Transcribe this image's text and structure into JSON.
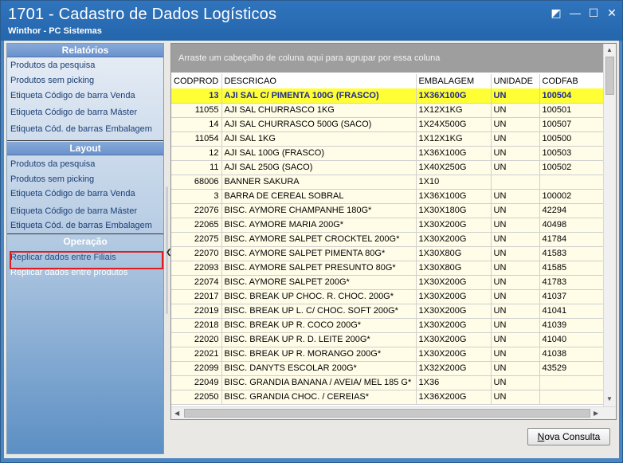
{
  "window": {
    "title": "1701 - Cadastro de Dados Logísticos",
    "subtitle": "Winthor - PC Sistemas",
    "controls": [
      "◩",
      "—",
      "☐",
      "✕"
    ]
  },
  "sidebar": {
    "sections": [
      {
        "header": "Relatórios",
        "items": [
          "Produtos da pesquisa",
          "Produtos sem picking",
          "Etiqueta Código de barra Venda",
          "Etiqueta Código de barra Máster",
          "Etiqueta Cód. de barras Embalagem"
        ]
      },
      {
        "header": "Layout",
        "items": [
          "Produtos da pesquisa",
          "Produtos sem picking",
          "Etiqueta Código de barra Venda",
          "Etiqueta Código de barra Máster",
          "Etiqueta Cód. de barras Embalagem"
        ]
      },
      {
        "header": "Operação",
        "items": [
          "Replicar dados entre Filiais",
          "Replicar dados entre produtos"
        ]
      }
    ]
  },
  "grid": {
    "group_panel_text": "Arraste um cabeçalho de coluna aqui para agrupar por essa coluna",
    "columns": [
      "CODPROD",
      "DESCRICAO",
      "EMBALAGEM",
      "UNIDADE",
      "CODFAB"
    ],
    "rows": [
      [
        "13",
        "AJI SAL C/ PIMENTA 100G (FRASCO)",
        "1X36X100G",
        "UN",
        "100504"
      ],
      [
        "11055",
        "AJI SAL CHURRASCO 1KG",
        "1X12X1KG",
        "UN",
        "100501"
      ],
      [
        "14",
        "AJI SAL CHURRASCO 500G (SACO)",
        "1X24X500G",
        "UN",
        "100507"
      ],
      [
        "11054",
        "AJI SAL 1KG",
        "1X12X1KG",
        "UN",
        "100500"
      ],
      [
        "12",
        "AJI SAL 100G (FRASCO)",
        "1X36X100G",
        "UN",
        "100503"
      ],
      [
        "11",
        "AJI SAL 250G (SACO)",
        "1X40X250G",
        "UN",
        "100502"
      ],
      [
        "68006",
        "BANNER SAKURA",
        "1X10",
        "",
        ""
      ],
      [
        "3",
        "BARRA DE CEREAL SOBRAL",
        "1X36X100G",
        "UN",
        "100002"
      ],
      [
        "22076",
        "BISC. AYMORE CHAMPANHE  180G*",
        "1X30X180G",
        "UN",
        "42294"
      ],
      [
        "22065",
        "BISC. AYMORE MARIA 200G*",
        "1X30X200G",
        "UN",
        "40498"
      ],
      [
        "22075",
        "BISC. AYMORE SALPET CROCKTEL 200G*",
        "1X30X200G",
        "UN",
        "41784"
      ],
      [
        "22070",
        "BISC. AYMORE SALPET PIMENTA 80G*",
        "1X30X80G",
        "UN",
        "41583"
      ],
      [
        "22093",
        "BISC. AYMORE SALPET PRESUNTO 80G*",
        "1X30X80G",
        "UN",
        "41585"
      ],
      [
        "22074",
        "BISC. AYMORE SALPET 200G*",
        "1X30X200G",
        "UN",
        "41783"
      ],
      [
        "22017",
        "BISC. BREAK UP CHOC. R. CHOC. 200G*",
        "1X30X200G",
        "UN",
        "41037"
      ],
      [
        "22019",
        "BISC. BREAK UP L.  C/ CHOC. SOFT  200G*",
        "1X30X200G",
        "UN",
        "41041"
      ],
      [
        "22018",
        "BISC. BREAK UP R. COCO 200G*",
        "1X30X200G",
        "UN",
        "41039"
      ],
      [
        "22020",
        "BISC. BREAK UP R. D. LEITE 200G*",
        "1X30X200G",
        "UN",
        "41040"
      ],
      [
        "22021",
        "BISC. BREAK UP R. MORANGO 200G*",
        "1X30X200G",
        "UN",
        "41038"
      ],
      [
        "22099",
        "BISC. DANYTS ESCOLAR 200G*",
        "1X32X200G",
        "UN",
        "43529"
      ],
      [
        "22049",
        "BISC. GRANDIA BANANA / AVEIA/ MEL 185 G*",
        "1X36",
        "UN",
        ""
      ],
      [
        "22050",
        "BISC. GRANDIA CHOC. / CEREIAS*",
        "1X36X200G",
        "UN",
        ""
      ]
    ]
  },
  "actions": {
    "new_query_prefix": "N",
    "new_query_rest": "ova Consulta"
  }
}
